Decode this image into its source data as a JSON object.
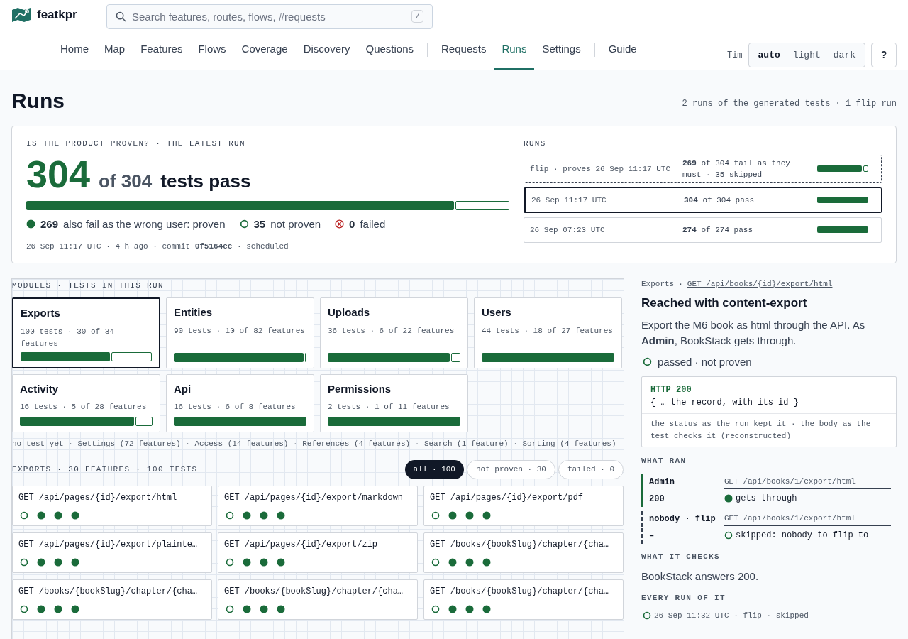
{
  "brand": "featkpr",
  "search": {
    "placeholder": "Search features, routes, flows, #requests",
    "shortcut": "/"
  },
  "nav": [
    [
      {
        "label": "Home",
        "selected": false
      },
      {
        "label": "Map",
        "selected": false
      },
      {
        "label": "Features",
        "selected": false
      },
      {
        "label": "Flows",
        "selected": false
      },
      {
        "label": "Coverage",
        "selected": false
      },
      {
        "label": "Discovery",
        "selected": false
      },
      {
        "label": "Questions",
        "selected": false
      }
    ],
    [
      {
        "label": "Requests",
        "selected": false
      },
      {
        "label": "Runs",
        "selected": true
      },
      {
        "label": "Settings",
        "selected": false
      }
    ],
    [
      {
        "label": "Guide",
        "selected": false
      }
    ]
  ],
  "user": "Tim",
  "theme": [
    {
      "label": "auto",
      "selected": true
    },
    {
      "label": "light",
      "selected": false
    },
    {
      "label": "dark",
      "selected": false
    }
  ],
  "help": "?",
  "title": "Runs",
  "summary": "2 runs of the generated tests · 1 flip run",
  "latest": {
    "heading": "IS THE PRODUCT PROVEN? · THE LATEST RUN",
    "count": "304",
    "of": "of 304",
    "label": "tests pass",
    "level": 0.885,
    "stats": [
      {
        "kind": "proven",
        "count": "269",
        "label": "also fail as the wrong user: proven"
      },
      {
        "kind": "not_proven",
        "count": "35",
        "label": "not proven"
      },
      {
        "kind": "failed",
        "count": "0",
        "label": "failed"
      }
    ],
    "meta": "26 Sep 11:17 UTC · 4 h ago · commit **0f5164ec** · scheduled"
  },
  "runs": {
    "heading": "RUNS",
    "items": [
      {
        "kind": "flip",
        "when": "flip · proves 26 Sep 11:17 UTC",
        "result": "**269** of 304 fail as they must · 35 skipped",
        "level": 0.88,
        "selected": false
      },
      {
        "kind": "run",
        "when": "26 Sep 11:17 UTC",
        "result": "**304** of 304 pass",
        "level": 1,
        "selected": true
      },
      {
        "kind": "run",
        "when": "26 Sep 07:23 UTC",
        "result": "**274** of 274 pass",
        "level": 1,
        "selected": false
      }
    ]
  },
  "modules": {
    "heading": "MODULES · TESTS IN THIS RUN",
    "items": [
      {
        "name": "Exports",
        "meta": "100 tests · 30 of 34 features",
        "level": 0.68,
        "selected": true
      },
      {
        "name": "Entities",
        "meta": "90 tests · 10 of 82 features",
        "level": 0.98,
        "selected": false
      },
      {
        "name": "Uploads",
        "meta": "36 tests · 6 of 22 features",
        "level": 0.92,
        "selected": false
      },
      {
        "name": "Users",
        "meta": "44 tests · 18 of 27 features",
        "level": 1,
        "selected": false
      },
      {
        "name": "Activity",
        "meta": "16 tests · 5 of 28 features",
        "level": 0.86,
        "selected": false
      },
      {
        "name": "Api",
        "meta": "16 tests · 6 of 8 features",
        "level": 1,
        "selected": false
      },
      {
        "name": "Permissions",
        "meta": "2 tests · 1 of 11 features",
        "level": 1,
        "selected": false
      }
    ],
    "untested": "no test yet · Settings (72 features) · Access (14 features) · References (4 features) · Search (1 feature) · Sorting (4 features)"
  },
  "features": {
    "heading": "EXPORTS · 30 FEATURES · 100 TESTS",
    "filters": [
      {
        "label": "all · 100",
        "selected": true
      },
      {
        "label": "not proven · 30",
        "selected": false
      },
      {
        "label": "failed · 0",
        "selected": false
      }
    ],
    "items": [
      {
        "route": "GET /api/pages/{id}/export/html",
        "tests": [
          {
            "proven": false
          },
          {
            "proven": true
          },
          {
            "proven": true
          },
          {
            "proven": true
          }
        ]
      },
      {
        "route": "GET /api/pages/{id}/export/markdown",
        "tests": [
          {
            "proven": false
          },
          {
            "proven": true
          },
          {
            "proven": true
          },
          {
            "proven": true
          }
        ]
      },
      {
        "route": "GET /api/pages/{id}/export/pdf",
        "tests": [
          {
            "proven": false
          },
          {
            "proven": true
          },
          {
            "proven": true
          },
          {
            "proven": true
          }
        ]
      },
      {
        "route": "GET /api/pages/{id}/export/plainte…",
        "tests": [
          {
            "proven": false
          },
          {
            "proven": true
          },
          {
            "proven": true
          },
          {
            "proven": true
          }
        ]
      },
      {
        "route": "GET /api/pages/{id}/export/zip",
        "tests": [
          {
            "proven": false
          },
          {
            "proven": true
          },
          {
            "proven": true
          },
          {
            "proven": true
          }
        ]
      },
      {
        "route": "GET /books/{bookSlug}/chapter/{cha…",
        "tests": [
          {
            "proven": false
          },
          {
            "proven": true
          },
          {
            "proven": true
          },
          {
            "proven": true
          }
        ]
      },
      {
        "route": "GET /books/{bookSlug}/chapter/{cha…",
        "tests": [
          {
            "proven": false
          },
          {
            "proven": true
          },
          {
            "proven": true
          },
          {
            "proven": true
          }
        ]
      },
      {
        "route": "GET /books/{bookSlug}/chapter/{cha…",
        "tests": [
          {
            "proven": false
          },
          {
            "proven": true
          },
          {
            "proven": true
          },
          {
            "proven": true
          }
        ]
      },
      {
        "route": "GET /books/{bookSlug}/chapter/{cha…",
        "tests": [
          {
            "proven": false
          },
          {
            "proven": true
          },
          {
            "proven": true
          },
          {
            "proven": true
          }
        ]
      }
    ]
  },
  "detail": {
    "module": "Exports",
    "separator": "·",
    "route": "GET /api/books/{id}/export/html",
    "title": "Reached with content-export",
    "description": "Export the M6 book as html through the API. As **Admin**, BookStack gets through.",
    "status": {
      "kind": "not_proven",
      "text": "passed · not proven"
    },
    "response": {
      "status": "HTTP 200",
      "body": "{ … the record, with its id }",
      "note": "the status as the run kept it · the body as the test checks it (reconstructed)"
    },
    "ran_heading": "WHAT RAN",
    "ran": [
      {
        "kind": "user",
        "who": "Admin",
        "code": "200",
        "request": "GET /api/books/1/export/html",
        "proven": true,
        "result": "gets through"
      },
      {
        "kind": "flip",
        "who": "nobody · flip",
        "code": "–",
        "request": "GET /api/books/1/export/html",
        "proven": false,
        "result": "skipped: nobody to flip to"
      }
    ],
    "checks_heading": "WHAT IT CHECKS",
    "checks": "BookStack answers 200.",
    "history_heading": "EVERY RUN OF IT",
    "history": [
      {
        "kind": "not_proven",
        "text": "26 Sep 11:32 UTC · flip · skipped"
      }
    ]
  }
}
